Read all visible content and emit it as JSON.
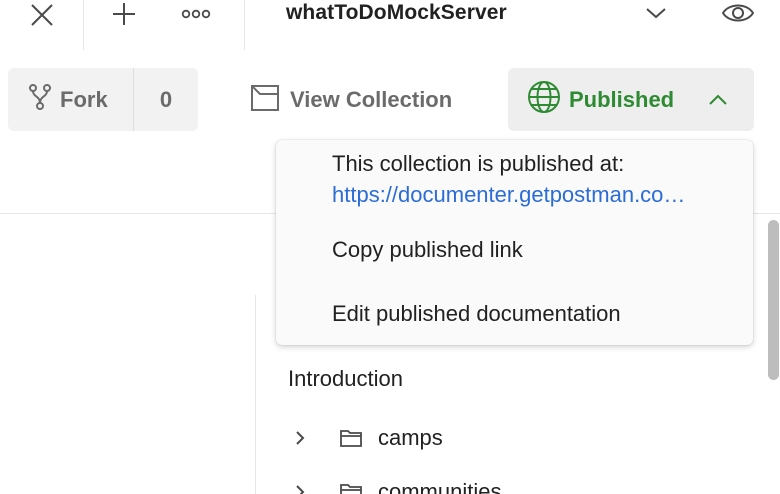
{
  "tabbar": {
    "close_icon": "close-icon",
    "add_icon": "plus-icon",
    "more_icon": "more-horizontal-icon",
    "workspace_name": "whatToDoMockServer",
    "chevron_icon": "chevron-down-icon",
    "watch_icon": "eye-icon"
  },
  "actions": {
    "fork_label": "Fork",
    "fork_count": "0",
    "fork_icon": "fork-icon",
    "view_label": "View Collection",
    "view_icon": "collection-icon",
    "published_label": "Published",
    "published_icon": "globe-icon",
    "published_chevron_icon": "chevron-up-icon"
  },
  "popover": {
    "title": "This collection is published at:",
    "link": "https://documenter.getpostman.com/view/whatToDoMockServer",
    "items": [
      {
        "label": "Copy published link"
      },
      {
        "label": "Edit published documentation"
      }
    ]
  },
  "tree": {
    "intro": "Introduction",
    "folders": [
      {
        "name": "camps"
      },
      {
        "name": "communities"
      }
    ]
  },
  "colors": {
    "published_green": "#2e8b33",
    "link_blue": "#2c6cd6",
    "muted_text": "#6b6b6b",
    "button_bg": "#f2f2f2"
  }
}
